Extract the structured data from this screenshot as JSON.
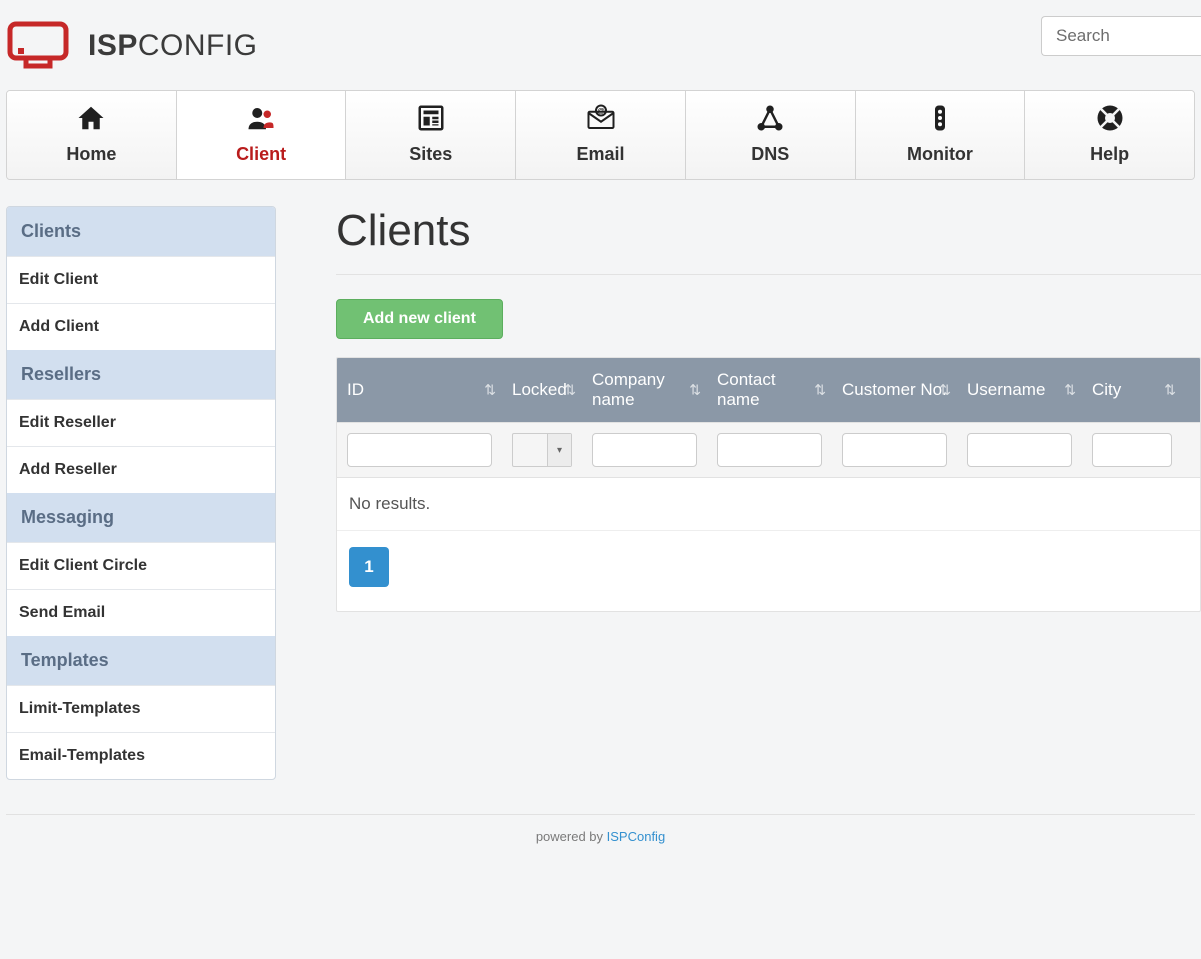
{
  "search": {
    "placeholder": "Search"
  },
  "brand": {
    "part1": "ISP",
    "part2": "CONFIG"
  },
  "nav": [
    {
      "id": "home",
      "label": "Home"
    },
    {
      "id": "client",
      "label": "Client"
    },
    {
      "id": "sites",
      "label": "Sites"
    },
    {
      "id": "email",
      "label": "Email"
    },
    {
      "id": "dns",
      "label": "DNS"
    },
    {
      "id": "monitor",
      "label": "Monitor"
    },
    {
      "id": "help",
      "label": "Help"
    }
  ],
  "activeNav": "client",
  "sidebar": [
    {
      "header": "Clients",
      "links": [
        "Edit Client",
        "Add Client"
      ]
    },
    {
      "header": "Resellers",
      "links": [
        "Edit Reseller",
        "Add Reseller"
      ]
    },
    {
      "header": "Messaging",
      "links": [
        "Edit Client Circle",
        "Send Email"
      ]
    },
    {
      "header": "Templates",
      "links": [
        "Limit-Templates",
        "Email-Templates"
      ]
    }
  ],
  "page": {
    "title": "Clients",
    "addButton": "Add new client"
  },
  "columns": {
    "id": "ID",
    "locked": "Locked",
    "company": "Company name",
    "contact": "Contact name",
    "customer": "Customer No.",
    "username": "Username",
    "city": "City"
  },
  "table": {
    "noResults": "No results.",
    "rows": []
  },
  "pager": {
    "pages": [
      "1"
    ],
    "current": "1"
  },
  "footer": {
    "text": "powered by ",
    "linkText": "ISPConfig"
  },
  "colors": {
    "brandRed": "#c62828",
    "navActive": "#b91c1c",
    "primaryBlue": "#3390cf",
    "addGreen": "#71c173",
    "headerGrey": "#8b98a7",
    "sideHeaderBg": "#d2dfef"
  }
}
